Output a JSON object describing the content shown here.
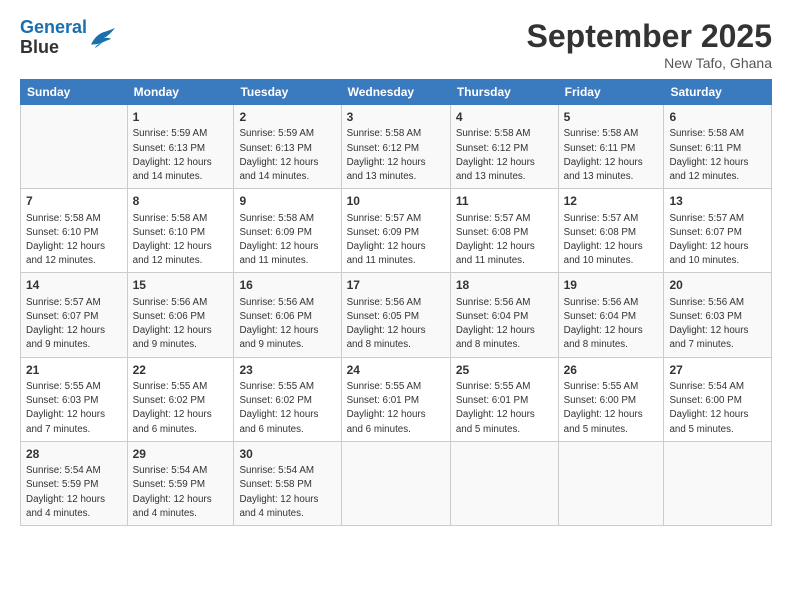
{
  "header": {
    "logo_line1": "General",
    "logo_line2": "Blue",
    "month_title": "September 2025",
    "location": "New Tafo, Ghana"
  },
  "weekdays": [
    "Sunday",
    "Monday",
    "Tuesday",
    "Wednesday",
    "Thursday",
    "Friday",
    "Saturday"
  ],
  "weeks": [
    [
      {
        "day": "",
        "info": ""
      },
      {
        "day": "1",
        "info": "Sunrise: 5:59 AM\nSunset: 6:13 PM\nDaylight: 12 hours\nand 14 minutes."
      },
      {
        "day": "2",
        "info": "Sunrise: 5:59 AM\nSunset: 6:13 PM\nDaylight: 12 hours\nand 14 minutes."
      },
      {
        "day": "3",
        "info": "Sunrise: 5:58 AM\nSunset: 6:12 PM\nDaylight: 12 hours\nand 13 minutes."
      },
      {
        "day": "4",
        "info": "Sunrise: 5:58 AM\nSunset: 6:12 PM\nDaylight: 12 hours\nand 13 minutes."
      },
      {
        "day": "5",
        "info": "Sunrise: 5:58 AM\nSunset: 6:11 PM\nDaylight: 12 hours\nand 13 minutes."
      },
      {
        "day": "6",
        "info": "Sunrise: 5:58 AM\nSunset: 6:11 PM\nDaylight: 12 hours\nand 12 minutes."
      }
    ],
    [
      {
        "day": "7",
        "info": "Sunrise: 5:58 AM\nSunset: 6:10 PM\nDaylight: 12 hours\nand 12 minutes."
      },
      {
        "day": "8",
        "info": "Sunrise: 5:58 AM\nSunset: 6:10 PM\nDaylight: 12 hours\nand 12 minutes."
      },
      {
        "day": "9",
        "info": "Sunrise: 5:58 AM\nSunset: 6:09 PM\nDaylight: 12 hours\nand 11 minutes."
      },
      {
        "day": "10",
        "info": "Sunrise: 5:57 AM\nSunset: 6:09 PM\nDaylight: 12 hours\nand 11 minutes."
      },
      {
        "day": "11",
        "info": "Sunrise: 5:57 AM\nSunset: 6:08 PM\nDaylight: 12 hours\nand 11 minutes."
      },
      {
        "day": "12",
        "info": "Sunrise: 5:57 AM\nSunset: 6:08 PM\nDaylight: 12 hours\nand 10 minutes."
      },
      {
        "day": "13",
        "info": "Sunrise: 5:57 AM\nSunset: 6:07 PM\nDaylight: 12 hours\nand 10 minutes."
      }
    ],
    [
      {
        "day": "14",
        "info": "Sunrise: 5:57 AM\nSunset: 6:07 PM\nDaylight: 12 hours\nand 9 minutes."
      },
      {
        "day": "15",
        "info": "Sunrise: 5:56 AM\nSunset: 6:06 PM\nDaylight: 12 hours\nand 9 minutes."
      },
      {
        "day": "16",
        "info": "Sunrise: 5:56 AM\nSunset: 6:06 PM\nDaylight: 12 hours\nand 9 minutes."
      },
      {
        "day": "17",
        "info": "Sunrise: 5:56 AM\nSunset: 6:05 PM\nDaylight: 12 hours\nand 8 minutes."
      },
      {
        "day": "18",
        "info": "Sunrise: 5:56 AM\nSunset: 6:04 PM\nDaylight: 12 hours\nand 8 minutes."
      },
      {
        "day": "19",
        "info": "Sunrise: 5:56 AM\nSunset: 6:04 PM\nDaylight: 12 hours\nand 8 minutes."
      },
      {
        "day": "20",
        "info": "Sunrise: 5:56 AM\nSunset: 6:03 PM\nDaylight: 12 hours\nand 7 minutes."
      }
    ],
    [
      {
        "day": "21",
        "info": "Sunrise: 5:55 AM\nSunset: 6:03 PM\nDaylight: 12 hours\nand 7 minutes."
      },
      {
        "day": "22",
        "info": "Sunrise: 5:55 AM\nSunset: 6:02 PM\nDaylight: 12 hours\nand 6 minutes."
      },
      {
        "day": "23",
        "info": "Sunrise: 5:55 AM\nSunset: 6:02 PM\nDaylight: 12 hours\nand 6 minutes."
      },
      {
        "day": "24",
        "info": "Sunrise: 5:55 AM\nSunset: 6:01 PM\nDaylight: 12 hours\nand 6 minutes."
      },
      {
        "day": "25",
        "info": "Sunrise: 5:55 AM\nSunset: 6:01 PM\nDaylight: 12 hours\nand 5 minutes."
      },
      {
        "day": "26",
        "info": "Sunrise: 5:55 AM\nSunset: 6:00 PM\nDaylight: 12 hours\nand 5 minutes."
      },
      {
        "day": "27",
        "info": "Sunrise: 5:54 AM\nSunset: 6:00 PM\nDaylight: 12 hours\nand 5 minutes."
      }
    ],
    [
      {
        "day": "28",
        "info": "Sunrise: 5:54 AM\nSunset: 5:59 PM\nDaylight: 12 hours\nand 4 minutes."
      },
      {
        "day": "29",
        "info": "Sunrise: 5:54 AM\nSunset: 5:59 PM\nDaylight: 12 hours\nand 4 minutes."
      },
      {
        "day": "30",
        "info": "Sunrise: 5:54 AM\nSunset: 5:58 PM\nDaylight: 12 hours\nand 4 minutes."
      },
      {
        "day": "",
        "info": ""
      },
      {
        "day": "",
        "info": ""
      },
      {
        "day": "",
        "info": ""
      },
      {
        "day": "",
        "info": ""
      }
    ]
  ]
}
